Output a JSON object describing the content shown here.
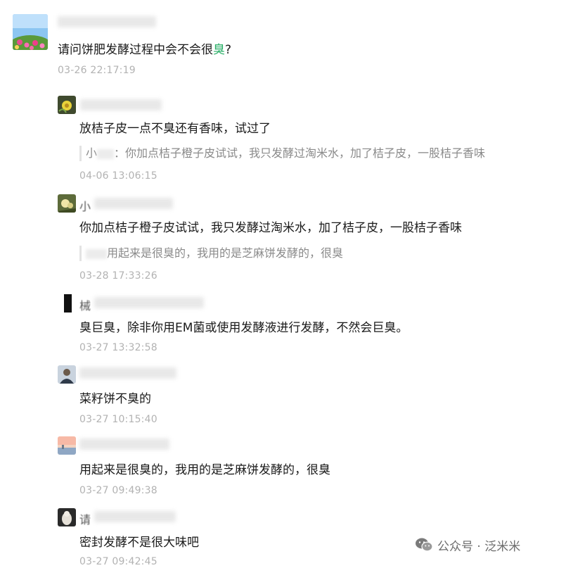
{
  "post": {
    "question_prefix": "请问饼肥发酵过程中会不会很",
    "question_keyword": "臭",
    "question_suffix": "?",
    "time": "03-26 22:17:19"
  },
  "replies": [
    {
      "name_visible": "",
      "text": "放桔子皮一点不臭还有香味，试过了",
      "quote_name": "小",
      "quote_text": "：你加点桔子橙子皮试试，我只发酵过淘米水，加了桔子皮，一股桔子香味",
      "time": "04-06 13:06:15"
    },
    {
      "name_visible": "小",
      "text": "你加点桔子橙子皮试试，我只发酵过淘米水，加了桔子皮，一股桔子香味",
      "quote_name": "",
      "quote_text": "用起来是很臭的，我用的是芝麻饼发酵的，很臭",
      "time": "03-28 17:33:26"
    },
    {
      "name_visible": "械",
      "text": "臭巨臭，除非你用EM菌或使用发酵液进行发酵，不然会巨臭。",
      "time": "03-27 13:32:58"
    },
    {
      "name_visible": "",
      "text": "菜籽饼不臭的",
      "time": "03-27 10:15:40"
    },
    {
      "name_visible": "",
      "text": "用起来是很臭的，我用的是芝麻饼发酵的，很臭",
      "time": "03-27 09:49:38"
    },
    {
      "name_visible": "请",
      "text": "密封发酵不是很大味吧",
      "time": "03-27 09:42:45"
    }
  ],
  "watermark": {
    "text": "公众号 · 泛米米",
    "icon": "wechat-icon"
  },
  "colors": {
    "keyword": "#2aae67",
    "time": "#b2b2b2",
    "quote_text": "#8a8a8a"
  }
}
